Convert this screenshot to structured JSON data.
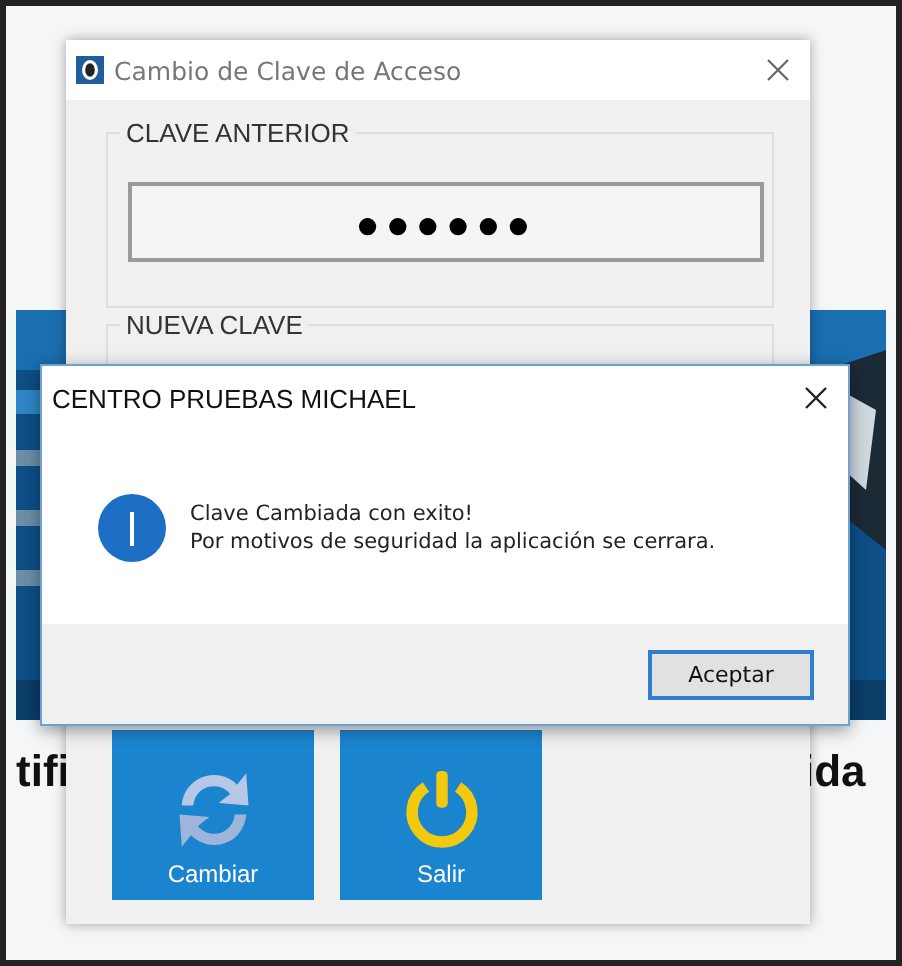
{
  "background_app": {
    "kind": "picture",
    "left_heading_fragment": "tifi",
    "right_heading_fragment": "ida"
  },
  "password_dialog": {
    "title": "Cambio de Clave de Acceso",
    "groups": [
      {
        "label": "CLAVE ANTERIOR",
        "value": "●●●●●●"
      },
      {
        "label": "NUEVA CLAVE"
      }
    ],
    "buttons": [
      {
        "label": "Cambiar",
        "kind": "refresh"
      },
      {
        "label": "Salir",
        "kind": "power"
      }
    ]
  },
  "message_box": {
    "title": "CENTRO PRUEBAS MICHAEL",
    "lines": [
      "Clave Cambiada con exito!",
      "Por motivos de seguridad la aplicación se cerrara."
    ],
    "buttons": [
      {
        "label": "Aceptar",
        "default": true
      }
    ]
  }
}
